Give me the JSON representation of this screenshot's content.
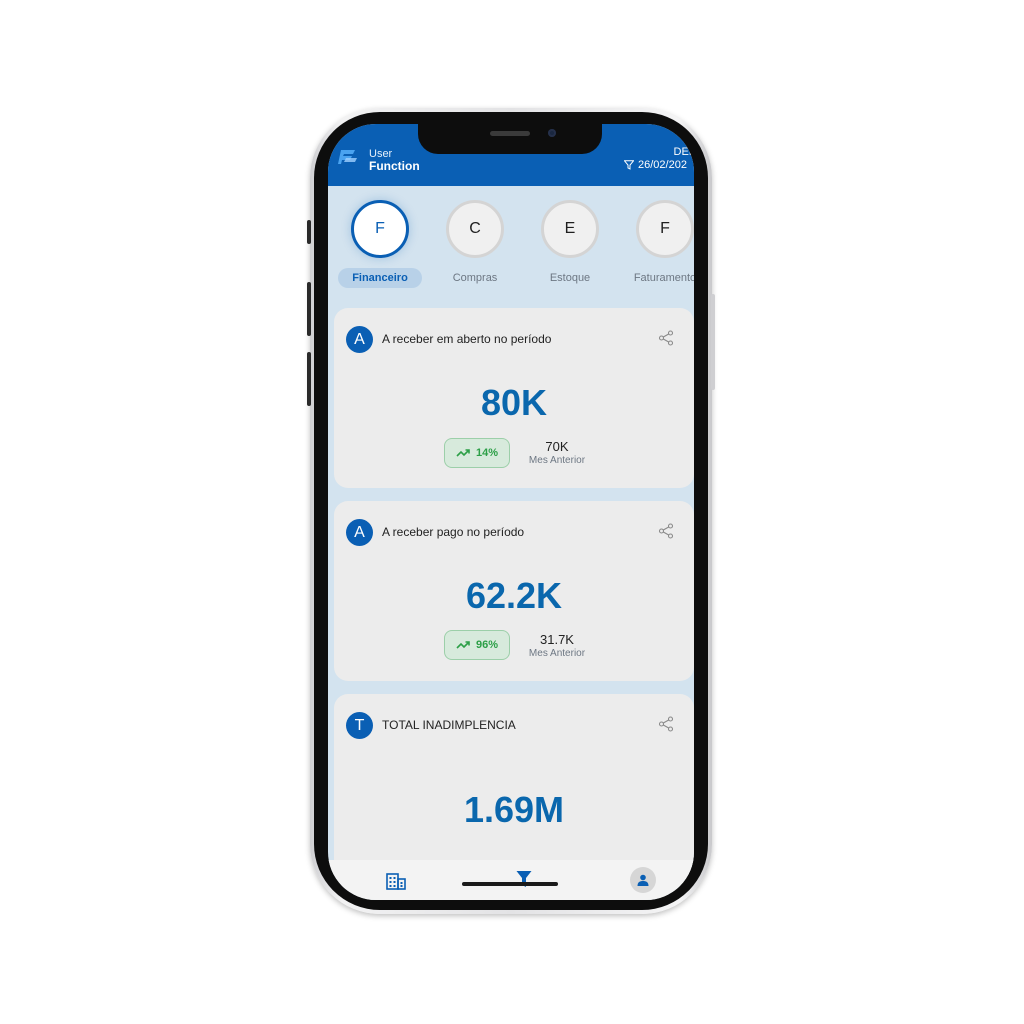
{
  "header": {
    "brand_line1": "User",
    "brand_line2": "Function",
    "company": "DEM",
    "date": "26/02/202"
  },
  "modules": [
    {
      "initial": "F",
      "label": "Financeiro",
      "active": true
    },
    {
      "initial": "C",
      "label": "Compras",
      "active": false
    },
    {
      "initial": "E",
      "label": "Estoque",
      "active": false
    },
    {
      "initial": "F",
      "label": "Faturamento",
      "active": false
    }
  ],
  "cards": [
    {
      "avatar": "A",
      "title": "A receber em aberto no período",
      "value": "80K",
      "trend": "14%",
      "prev_value": "70K",
      "prev_label": "Mes Anterior"
    },
    {
      "avatar": "A",
      "title": "A receber pago no período",
      "value": "62.2K",
      "trend": "96%",
      "prev_value": "31.7K",
      "prev_label": "Mes Anterior"
    },
    {
      "avatar": "T",
      "title": "TOTAL INADIMPLENCIA",
      "value": "1.69M"
    }
  ],
  "icons": {
    "logo": "brand-logo-icon",
    "filter": "filter-icon",
    "share": "share-icon",
    "trend": "trending-up-icon",
    "nav_1": "building-icon",
    "nav_2": "filter-icon",
    "nav_3": "user-icon"
  },
  "colors": {
    "primary": "#0a5fb4",
    "value": "#0a67ad",
    "positive": "#2c9f47",
    "background": "#d3e3ef",
    "card": "#ececec"
  }
}
